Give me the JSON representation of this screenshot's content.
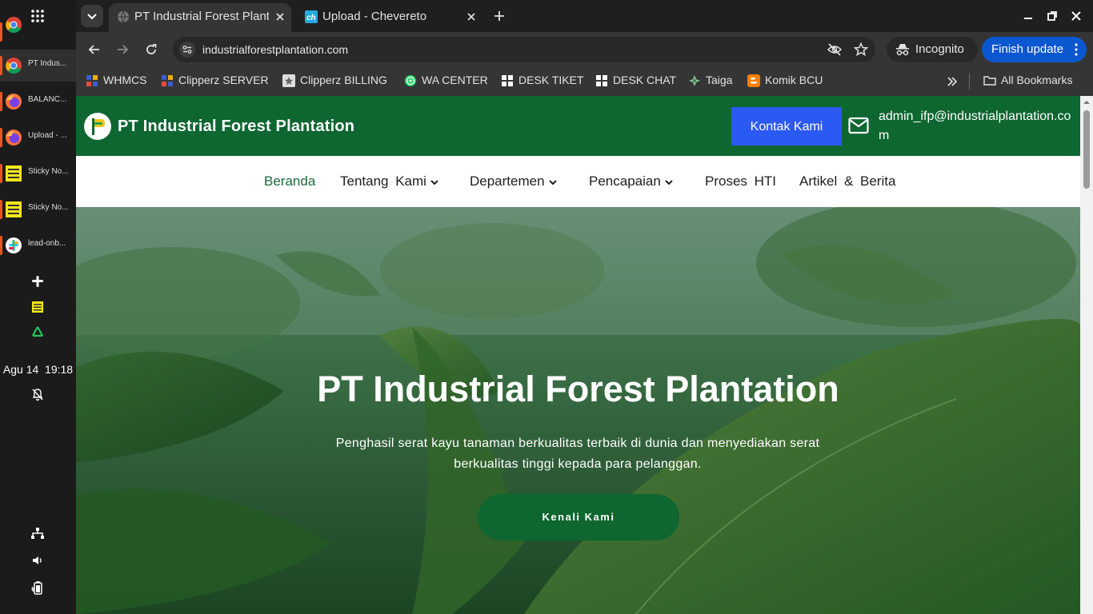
{
  "taskbar": {
    "items": [
      {
        "label": "",
        "icon": "chrome-icon"
      },
      {
        "label": "PT Indus...",
        "icon": "chrome-icon"
      },
      {
        "label": "BALANC...",
        "icon": "firefox-icon"
      },
      {
        "label": "Upload - ...",
        "icon": "firefox-icon"
      },
      {
        "label": "Sticky No...",
        "icon": "sticky-notes-icon"
      },
      {
        "label": "Sticky No...",
        "icon": "sticky-notes-icon"
      },
      {
        "label": "lead-onb...",
        "icon": "slack-icon"
      }
    ],
    "date": "Agu 14",
    "time": "19:18"
  },
  "browser": {
    "tabs": [
      {
        "title": "PT Industrial Forest Plantation",
        "active": true
      },
      {
        "title": "Upload - Chevereto",
        "active": false
      }
    ],
    "url": "industrialforestplantation.com",
    "incognito_label": "Incognito",
    "update_label": "Finish update",
    "bookmarks": [
      {
        "label": "WHMCS"
      },
      {
        "label": "Clipperz SERVER"
      },
      {
        "label": "Clipperz BILLING"
      },
      {
        "label": "WA CENTER"
      },
      {
        "label": "DESK TIKET"
      },
      {
        "label": "DESK CHAT"
      },
      {
        "label": "Taiga"
      },
      {
        "label": "Komik BCU"
      }
    ],
    "all_bookmarks_label": "All Bookmarks"
  },
  "site": {
    "title": "PT Industrial Forest Plantation",
    "contact_button": "Kontak Kami",
    "email": "admin_ifp@industrialplantation.com",
    "nav": [
      "Beranda",
      "Tentang Kami",
      "Departemen",
      "Pencapaian",
      "Proses HTI",
      "Artikel & Berita"
    ],
    "hero": {
      "title": "PT Industrial Forest Plantation",
      "subtitle": "Penghasil serat kayu tanaman berkualitas terbaik di dunia dan menyediakan serat berkualitas tinggi kepada para pelanggan.",
      "button": "Kenali Kami"
    }
  },
  "colors": {
    "brand_green": "#0e6630",
    "contact_blue": "#2b59f4",
    "update_blue": "#0b57d0",
    "active_nav": "#1a6b38",
    "taskbar_indicator": "#e95420"
  }
}
